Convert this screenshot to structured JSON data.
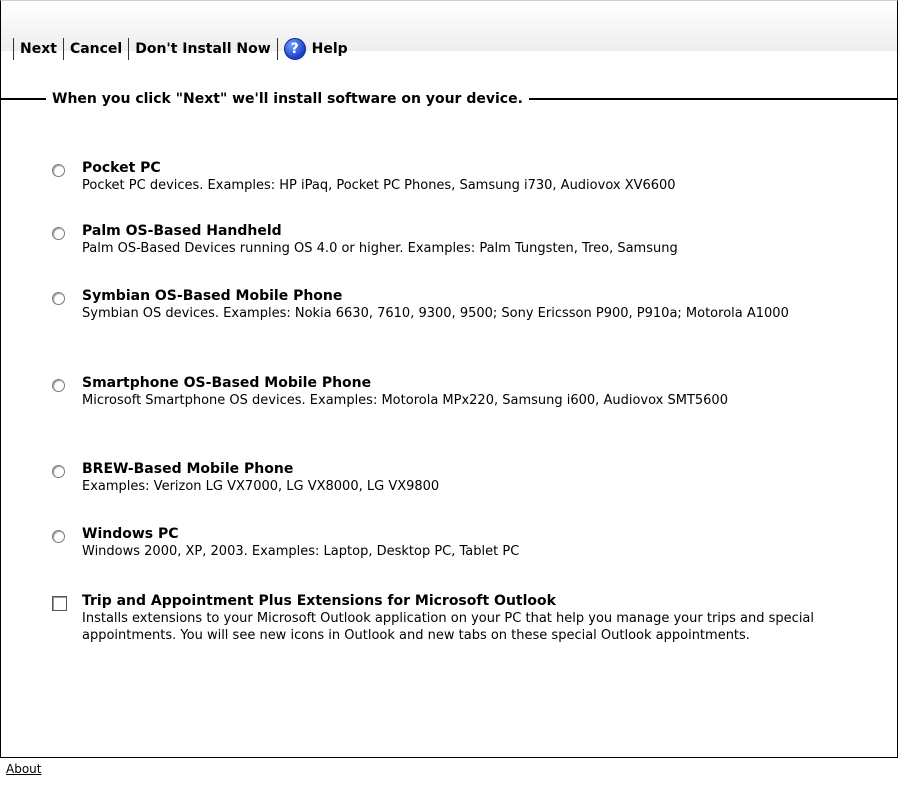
{
  "toolbar": {
    "next": "Next",
    "cancel": "Cancel",
    "dont_install": "Don't Install Now",
    "help": "Help",
    "help_icon": "help-question-icon"
  },
  "instruction": "When you click \"Next\" we'll install software on your device.",
  "options": [
    {
      "title": "Pocket PC",
      "desc": "Pocket PC devices. Examples: HP iPaq, Pocket PC Phones, Samsung i730, Audiovox XV6600",
      "type": "radio"
    },
    {
      "title": "Palm OS-Based Handheld",
      "desc": "Palm OS-Based Devices running OS 4.0 or higher. Examples: Palm Tungsten, Treo, Samsung",
      "type": "radio"
    },
    {
      "title": "Symbian OS-Based Mobile Phone",
      "desc": "Symbian OS devices. Examples: Nokia 6630, 7610, 9300, 9500; Sony Ericsson P900, P910a; Motorola A1000",
      "type": "radio"
    },
    {
      "title": "Smartphone OS-Based Mobile Phone",
      "desc": "Microsoft Smartphone OS devices. Examples: Motorola MPx220, Samsung i600, Audiovox SMT5600",
      "type": "radio"
    },
    {
      "title": "BREW-Based Mobile Phone",
      "desc": "Examples: Verizon LG VX7000, LG VX8000, LG VX9800",
      "type": "radio"
    },
    {
      "title": "Windows PC",
      "desc": "Windows 2000, XP, 2003. Examples: Laptop, Desktop PC, Tablet PC",
      "type": "radio"
    },
    {
      "title": "Trip and Appointment Plus Extensions for Microsoft Outlook",
      "desc": "Installs extensions to your Microsoft Outlook application on your PC that help you manage your trips and special appointments. You will see new icons in Outlook and new tabs on these special Outlook appointments.",
      "type": "checkbox"
    }
  ],
  "footer": {
    "about": "About"
  }
}
